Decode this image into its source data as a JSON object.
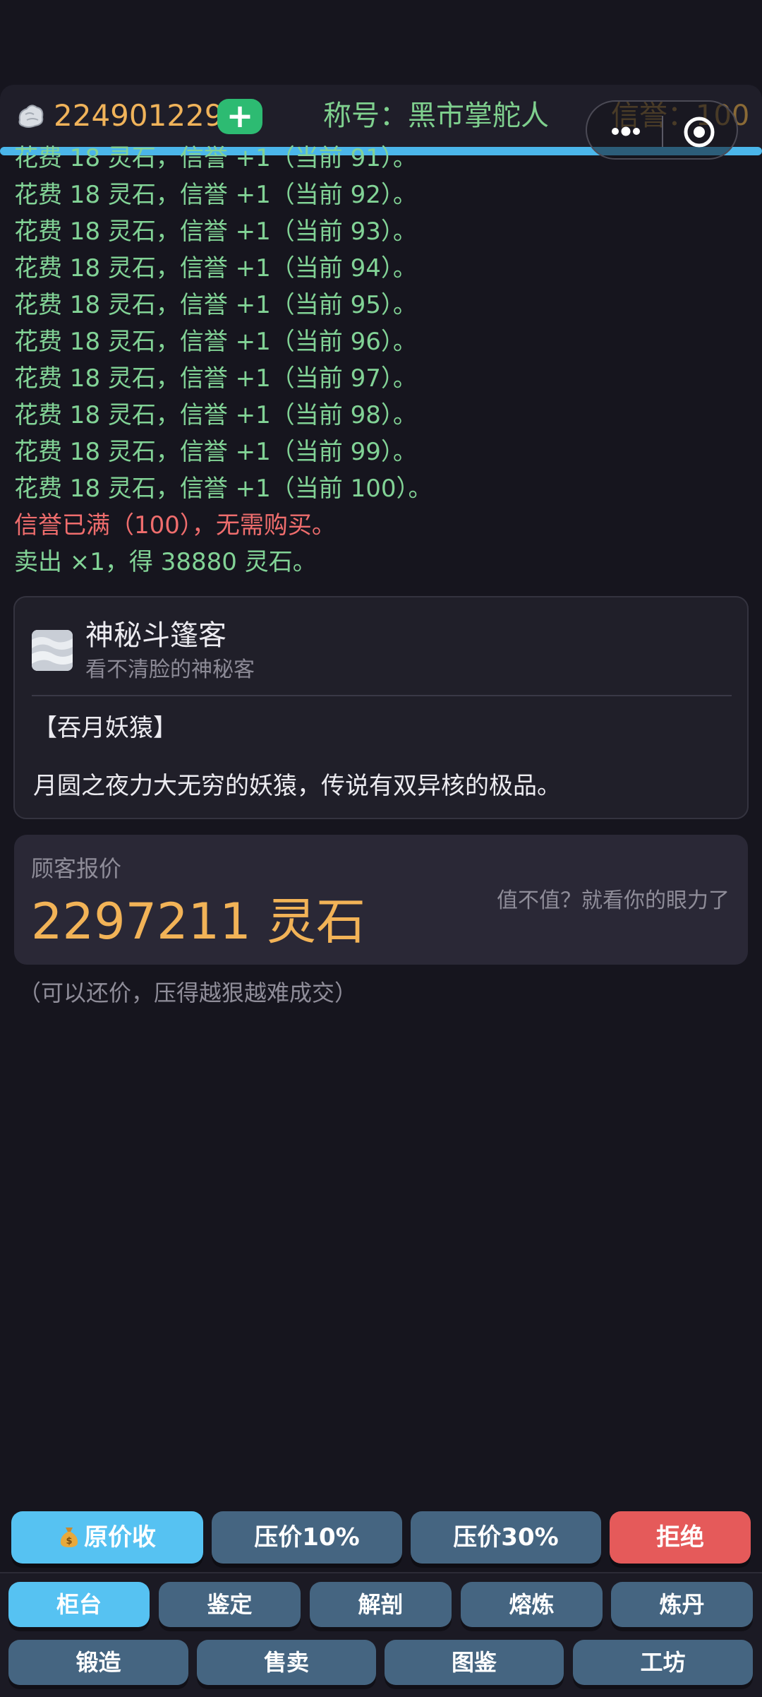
{
  "header": {
    "balance": "224901229",
    "add_label": "+",
    "title": "称号：黑市掌舵人",
    "reputation": "信誉：100"
  },
  "log": [
    {
      "text": "花费 18 灵石，信誉 +1（当前 91）。",
      "type": "info"
    },
    {
      "text": "花费 18 灵石，信誉 +1（当前 92）。",
      "type": "info"
    },
    {
      "text": "花费 18 灵石，信誉 +1（当前 93）。",
      "type": "info"
    },
    {
      "text": "花费 18 灵石，信誉 +1（当前 94）。",
      "type": "info"
    },
    {
      "text": "花费 18 灵石，信誉 +1（当前 95）。",
      "type": "info"
    },
    {
      "text": "花费 18 灵石，信誉 +1（当前 96）。",
      "type": "info"
    },
    {
      "text": "花费 18 灵石，信誉 +1（当前 97）。",
      "type": "info"
    },
    {
      "text": "花费 18 灵石，信誉 +1（当前 98）。",
      "type": "info"
    },
    {
      "text": "花费 18 灵石，信誉 +1（当前 99）。",
      "type": "info"
    },
    {
      "text": "花费 18 灵石，信誉 +1（当前 100）。",
      "type": "info"
    },
    {
      "text": "信誉已满（100），无需购买。",
      "type": "warn"
    },
    {
      "text": "卖出 ×1，得 38880 灵石。",
      "type": "info"
    }
  ],
  "customer": {
    "name": "神秘斗篷客",
    "desc": "看不清脸的神秘客",
    "item_name": "【吞月妖猿】",
    "item_desc": "月圆之夜力大无穷的妖猿，传说有双异核的极品。"
  },
  "offer": {
    "label": "顾客报价",
    "price": "2297211 灵石",
    "hint": "值不值？就看你的眼力了"
  },
  "bargain_note": "（可以还价，压得越狠越难成交）",
  "actions": {
    "accept": "原价收",
    "cut10": "压价10%",
    "cut30": "压价30%",
    "reject": "拒绝"
  },
  "nav": {
    "row1": [
      "柜台",
      "鉴定",
      "解剖",
      "熔炼",
      "炼丹"
    ],
    "row2": [
      "锻造",
      "售卖",
      "图鉴",
      "工坊"
    ],
    "active": "柜台"
  },
  "colors": {
    "background": "#16151e",
    "gold": "#f0b35a",
    "green_text": "#82d396",
    "warn_text": "#ef6d6d",
    "accent_blue": "#56c2f2",
    "slate_button": "#456581",
    "reject_red": "#e55a5a",
    "add_green": "#2dbb72"
  },
  "icons": {
    "currency": "spirit-stone-icon",
    "customer_avatar": "cloak-avatar-icon",
    "accept": "money-bag-icon",
    "menu": "more-dots-icon",
    "close": "target-circle-icon"
  }
}
